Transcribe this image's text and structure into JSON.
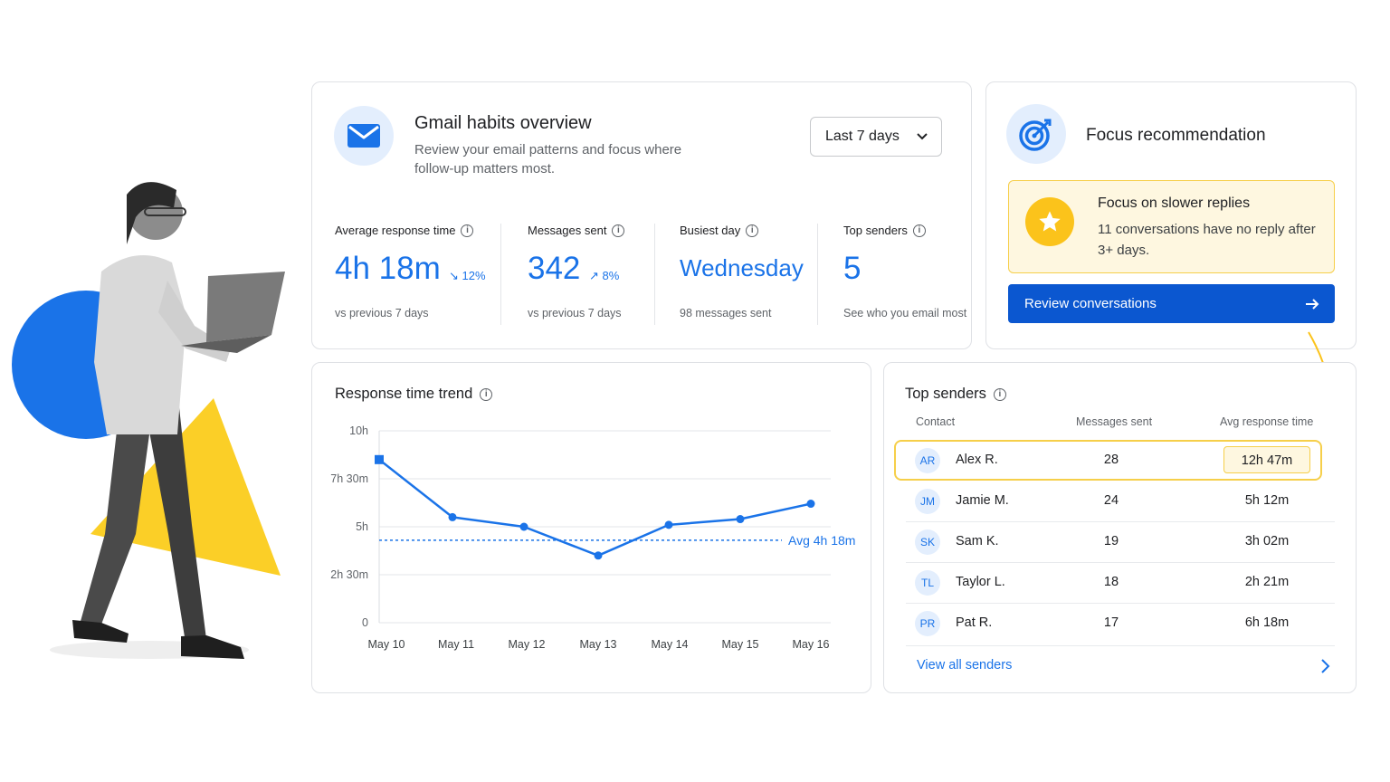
{
  "colors": {
    "accent": "#1a73e8",
    "button": "#0b57d0",
    "highlight": "#f6cf4a",
    "highlight_bg": "#fef7e0",
    "decor_blue": "#1a73e8",
    "decor_yellow": "#fbcf27"
  },
  "overview": {
    "icon": "mail-icon",
    "title": "Gmail habits overview",
    "subtitle": "Review your email patterns and focus where follow-up matters most.",
    "period_select": "Last 7 days",
    "stats": [
      {
        "label": "Average response time",
        "value": "4h 18m",
        "delta": "12%",
        "delta_icon": "trend-down-icon",
        "footnote": "vs previous 7 days"
      },
      {
        "label": "Messages sent",
        "value": "342",
        "delta": "8%",
        "delta_icon": "trend-up-icon",
        "footnote": "vs previous 7 days"
      },
      {
        "label": "Busiest day",
        "value": "Wednesday",
        "footnote": "98 messages sent"
      },
      {
        "label": "Top senders",
        "value": "5",
        "footnote": "See who you email most"
      }
    ]
  },
  "focus": {
    "icon": "target-icon",
    "title": "Focus recommendation",
    "card_icon": "star-icon",
    "card_title": "Focus on slower replies",
    "card_text": "11 conversations have no reply after 3+ days.",
    "button_label": "Review conversations"
  },
  "trend": {
    "title": "Response time trend",
    "avg_label": "Avg 4h 18m"
  },
  "chart_data": {
    "type": "line",
    "title": "Response time trend",
    "categories": [
      "May 10",
      "May 11",
      "May 12",
      "May 13",
      "May 14",
      "May 15",
      "May 16"
    ],
    "y_tick_labels": [
      "0",
      "2h 30m",
      "5h",
      "7h 30m",
      "10h"
    ],
    "y_tick_values": [
      0,
      2.5,
      5,
      7.5,
      10
    ],
    "series": [
      {
        "values": [
          8.5,
          5.5,
          5.0,
          3.5,
          5.1,
          5.4,
          6.2
        ]
      }
    ],
    "average_line": {
      "value": 4.3,
      "label": "Avg 4h 18m"
    },
    "ylim": [
      0,
      10
    ],
    "grid": true,
    "x_unit": "date",
    "y_unit": "hours"
  },
  "senders": {
    "title": "Top senders",
    "columns": [
      "Contact",
      "Messages sent",
      "Avg response time"
    ],
    "rows": [
      {
        "initials": "AR",
        "name": "Alex R.",
        "count": "28",
        "avg": "12h 47m"
      },
      {
        "initials": "JM",
        "name": "Jamie M.",
        "count": "24",
        "avg": "5h 12m"
      },
      {
        "initials": "SK",
        "name": "Sam K.",
        "count": "19",
        "avg": "3h 02m"
      },
      {
        "initials": "TL",
        "name": "Taylor L.",
        "count": "18",
        "avg": "2h 21m"
      },
      {
        "initials": "PR",
        "name": "Pat R.",
        "count": "17",
        "avg": "6h 18m"
      }
    ],
    "view_all": "View all senders"
  }
}
